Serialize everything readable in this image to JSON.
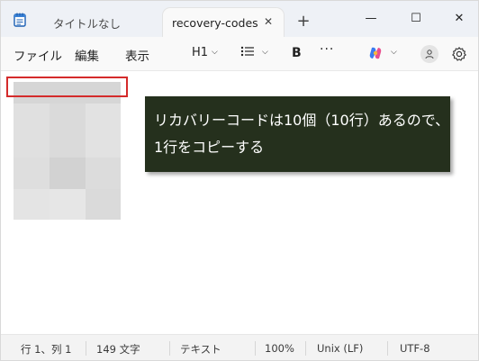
{
  "tabs": [
    {
      "label": "タイトルなし",
      "active": false
    },
    {
      "label": "recovery-codes",
      "active": true
    }
  ],
  "tab_close_glyph": "✕",
  "new_tab_glyph": "+",
  "window_controls": {
    "minimize": "—",
    "maximize": "☐",
    "close": "✕"
  },
  "menu": {
    "file": "ファイル",
    "edit": "編集",
    "view": "表示"
  },
  "toolbar": {
    "heading": "H1",
    "bold": "B",
    "more": "···",
    "chevron": "⌵"
  },
  "callout": {
    "line1": "リカバリーコードは10個（10行）あるので、",
    "line2": "1行をコピーする",
    "background": "#25301d"
  },
  "highlight_color": "#d42b2b",
  "status": {
    "position": "行 1、列 1",
    "chars": "149 文字",
    "format": "テキスト",
    "zoom": "100%",
    "line_ending": "Unix (LF)",
    "encoding": "UTF-8"
  },
  "icons": {
    "app": "notepad-icon",
    "copilot": "copilot-icon",
    "account": "account-icon",
    "settings": "gear-icon",
    "list": "bullet-list-icon"
  }
}
